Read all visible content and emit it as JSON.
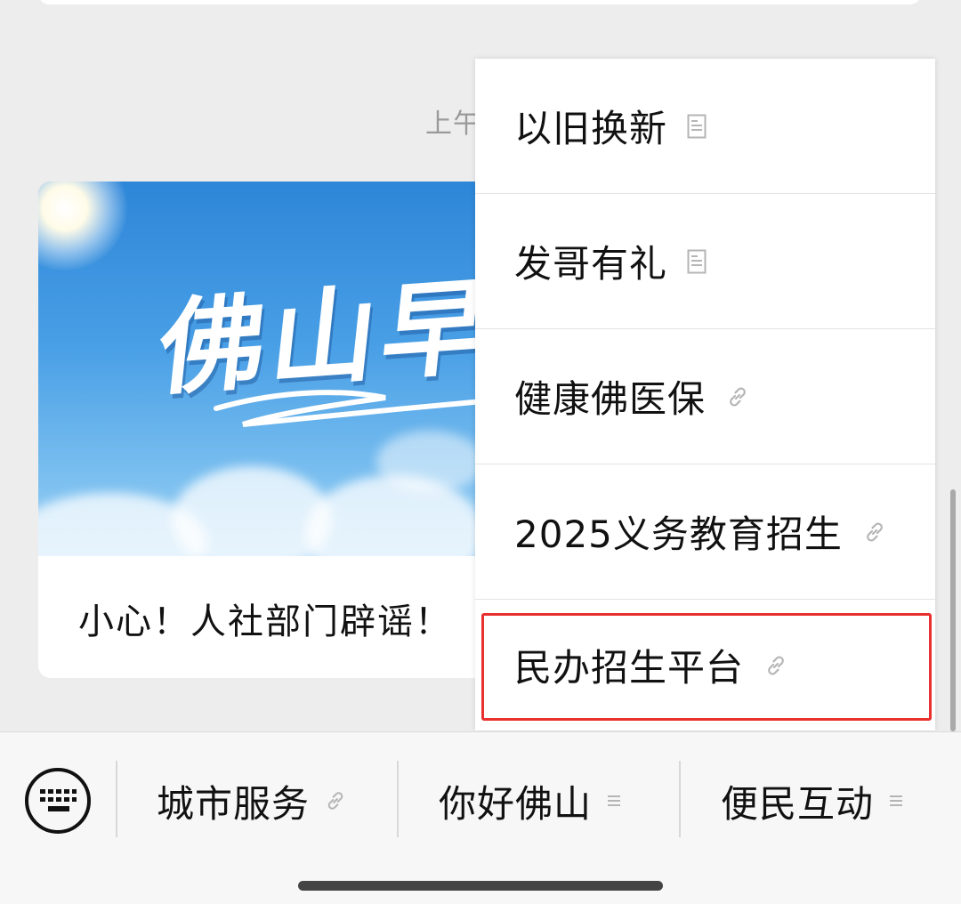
{
  "chat": {
    "timestamp": "上午",
    "article": {
      "cover_text": "佛山早班",
      "title": "小心！人社部门辟谣！"
    }
  },
  "popup_menu": {
    "items": [
      {
        "label": "以旧换新",
        "icon": "document-icon"
      },
      {
        "label": "发哥有礼",
        "icon": "document-icon"
      },
      {
        "label": "健康佛医保",
        "icon": "link-icon"
      },
      {
        "label": "2025义务教育招生",
        "icon": "link-icon"
      },
      {
        "label": "民办招生平台",
        "icon": "link-icon",
        "highlighted": true
      }
    ],
    "highlight_color": "#e8302e"
  },
  "bottom_bar": {
    "keyboard_icon": "keyboard-icon",
    "tabs": [
      {
        "label": "城市服务",
        "icon": "link-icon"
      },
      {
        "label": "你好佛山",
        "icon": "menu-lines-icon"
      },
      {
        "label": "便民互动",
        "icon": "menu-lines-icon"
      }
    ]
  }
}
